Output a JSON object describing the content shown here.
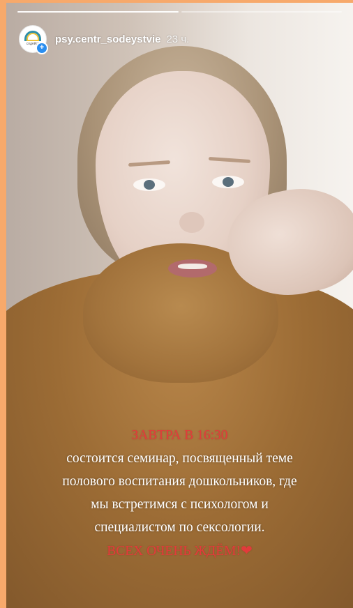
{
  "story": {
    "username": "psy.centr_sodeystvie",
    "time_ago": "23 ч.",
    "avatar_text": "содейст",
    "progress": {
      "segments": 2,
      "current": 1
    }
  },
  "caption": {
    "line1": "ЗАВТРА В 16:30",
    "line2": "состоится семинар, посвященный теме",
    "line3": "полового воспитания дошкольников, где",
    "line4": "мы встретимся с психологом и",
    "line5": "специалистом по сексологии.",
    "line6": "ВСЕХ ОЧЕНЬ ЖДЁМ!",
    "heart": "❤"
  },
  "colors": {
    "border": "#f7a96b",
    "caption_red": "#e23b3b",
    "badge_blue": "#2a8ef0"
  }
}
